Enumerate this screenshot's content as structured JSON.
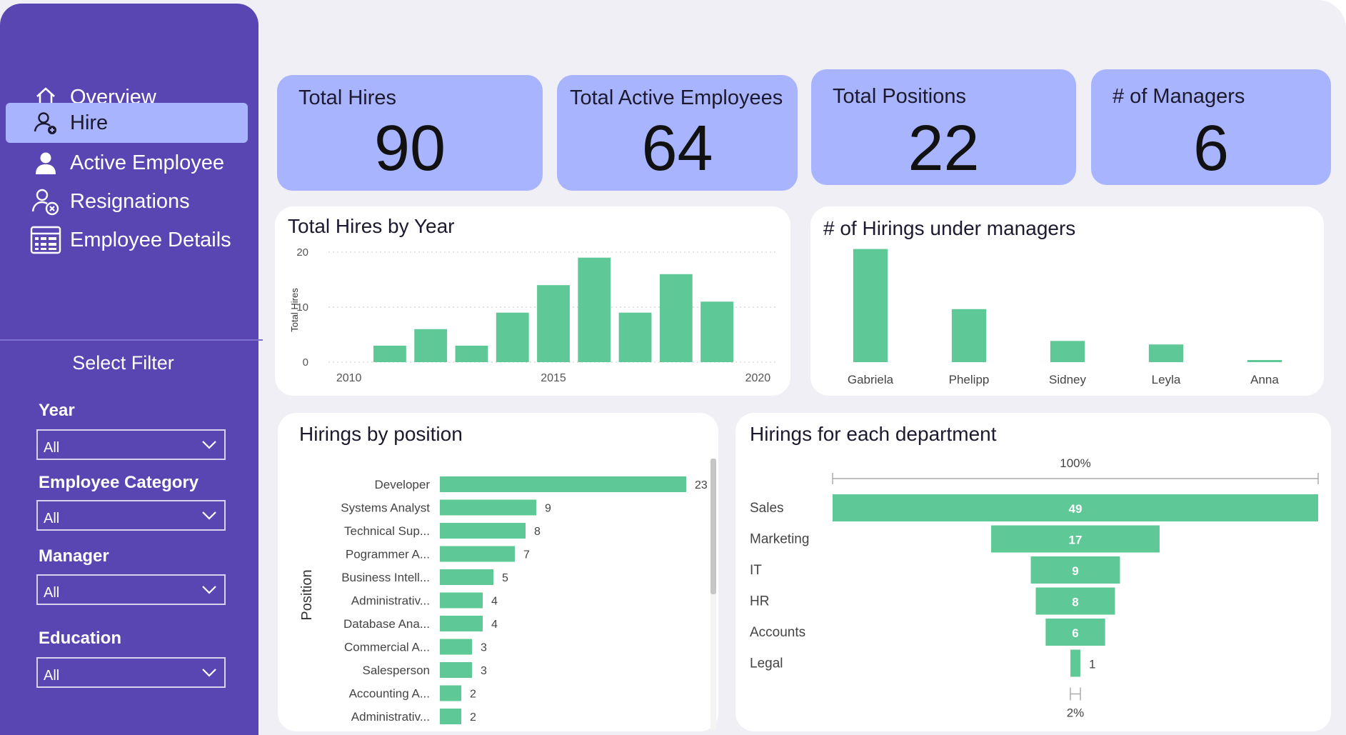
{
  "nav": {
    "items": [
      {
        "label": "Overview",
        "icon": "home-icon"
      },
      {
        "label": "Hire",
        "icon": "user-add-icon",
        "active": true
      },
      {
        "label": "Active Employee",
        "icon": "user-icon"
      },
      {
        "label": "Resignations",
        "icon": "user-remove-icon"
      },
      {
        "label": "Employee Details",
        "icon": "table-icon"
      }
    ]
  },
  "filters": {
    "title": "Select Filter",
    "year": {
      "label": "Year",
      "value": "All"
    },
    "category": {
      "label": "Employee Category",
      "value": "All"
    },
    "manager": {
      "label": "Manager",
      "value": "All"
    },
    "education": {
      "label": "Education",
      "value": "All"
    }
  },
  "kpis": {
    "total_hires": {
      "label": "Total Hires",
      "value": "90"
    },
    "active_employees": {
      "label": "Total Active Employees",
      "value": "64"
    },
    "total_positions": {
      "label": "Total Positions",
      "value": "22"
    },
    "managers": {
      "label": "# of Managers",
      "value": "6"
    }
  },
  "colors": {
    "sidebar": "#5a46b3",
    "accent": "#a9b4ff",
    "bar": "#5ec996",
    "background": "#f0eff5"
  },
  "chart_data": [
    {
      "type": "bar",
      "title": "Total Hires by Year",
      "ylabel": "Total Hires",
      "xlabel": "",
      "x": [
        2011,
        2012,
        2013,
        2014,
        2015,
        2016,
        2017,
        2018,
        2019
      ],
      "values": [
        3,
        6,
        3,
        9,
        14,
        19,
        9,
        16,
        11
      ],
      "xlim": [
        2009.5,
        2020.5
      ],
      "ylim": [
        0,
        20
      ],
      "xticks": [
        "2010",
        "2015",
        "2020"
      ],
      "yticks": [
        "0",
        "10",
        "20"
      ],
      "grid": true
    },
    {
      "type": "bar",
      "title": "# of Hirings under managers",
      "categories": [
        "Gabriela",
        "Phelipp",
        "Sidney",
        "Leyla",
        "Anna"
      ],
      "values": [
        16,
        7.5,
        3,
        2.5,
        0.3
      ],
      "ylim": [
        0,
        20
      ]
    },
    {
      "type": "bar",
      "orientation": "horizontal",
      "title": "Hirings by position",
      "ylabel": "Position",
      "categories": [
        "Developer",
        "Systems Analyst",
        "Technical Sup...",
        "Pogrammer A...",
        "Business Intell...",
        "Administrativ...",
        "Database Ana...",
        "Commercial A...",
        "Salesperson",
        "Accounting A...",
        "Administrativ..."
      ],
      "values": [
        23,
        9,
        8,
        7,
        5,
        4,
        4,
        3,
        3,
        2,
        2
      ],
      "xlim": [
        0,
        23
      ]
    },
    {
      "type": "funnel",
      "title": "Hirings for each department",
      "categories": [
        "Sales",
        "Marketing",
        "IT",
        "HR",
        "Accounts",
        "Legal"
      ],
      "values": [
        49,
        17,
        9,
        8,
        6,
        1
      ],
      "top_label": "100%",
      "bottom_label": "2%"
    }
  ]
}
